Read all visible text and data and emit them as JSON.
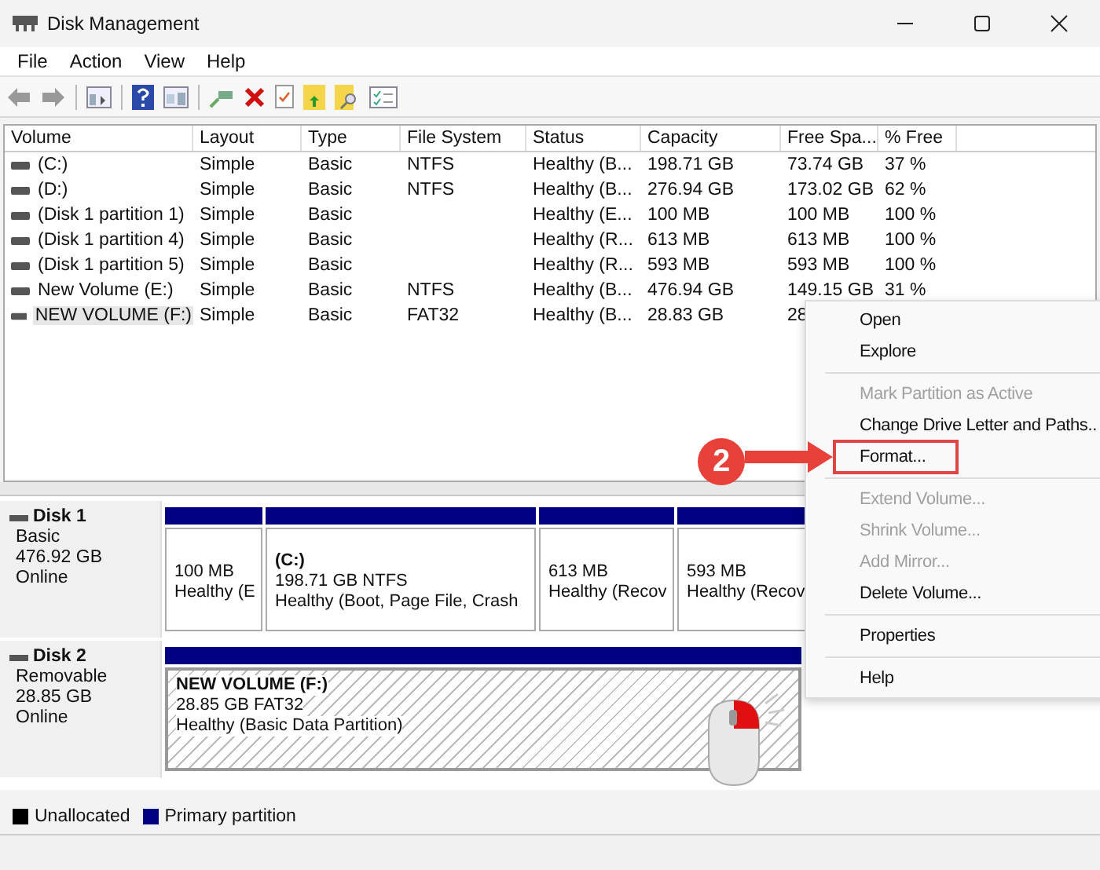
{
  "window": {
    "title": "Disk Management"
  },
  "menu_bar": [
    "File",
    "Action",
    "View",
    "Help"
  ],
  "table": {
    "columns": [
      "Volume",
      "Layout",
      "Type",
      "File System",
      "Status",
      "Capacity",
      "Free Spa...",
      "% Free"
    ],
    "rows": [
      {
        "selected": false,
        "cells": [
          "(C:)",
          "Simple",
          "Basic",
          "NTFS",
          "Healthy (B...",
          "198.71 GB",
          "73.74 GB",
          "37 %"
        ]
      },
      {
        "selected": false,
        "cells": [
          "(D:)",
          "Simple",
          "Basic",
          "NTFS",
          "Healthy (B...",
          "276.94 GB",
          "173.02 GB",
          "62 %"
        ]
      },
      {
        "selected": false,
        "cells": [
          "(Disk 1 partition 1)",
          "Simple",
          "Basic",
          "",
          "Healthy (E...",
          "100 MB",
          "100 MB",
          "100 %"
        ]
      },
      {
        "selected": false,
        "cells": [
          "(Disk 1 partition 4)",
          "Simple",
          "Basic",
          "",
          "Healthy (R...",
          "613 MB",
          "613 MB",
          "100 %"
        ]
      },
      {
        "selected": false,
        "cells": [
          "(Disk 1 partition 5)",
          "Simple",
          "Basic",
          "",
          "Healthy (R...",
          "593 MB",
          "593 MB",
          "100 %"
        ]
      },
      {
        "selected": false,
        "cells": [
          "New Volume (E:)",
          "Simple",
          "Basic",
          "NTFS",
          "Healthy (B...",
          "476.94 GB",
          "149.15 GB",
          "31 %"
        ]
      },
      {
        "selected": true,
        "cells": [
          "NEW VOLUME (F:)",
          "Simple",
          "Basic",
          "FAT32",
          "Healthy (B...",
          "28.83 GB",
          "28"
        ]
      }
    ]
  },
  "disks": [
    {
      "name": "Disk 1",
      "type": "Basic",
      "size": "476.92 GB",
      "status": "Online",
      "partitions": [
        {
          "size": "100 MB",
          "status": "Healthy (E",
          "selected": false
        },
        {
          "label": "(C:)",
          "size": "198.71 GB NTFS",
          "status": "Healthy (Boot, Page File, Crash",
          "selected": false
        },
        {
          "size": "613 MB",
          "status": "Healthy (Recov",
          "selected": false
        },
        {
          "size": "593 MB",
          "status": "Healthy (Recov",
          "selected": false
        }
      ]
    },
    {
      "name": "Disk 2",
      "type": "Removable",
      "size": "28.85 GB",
      "status": "Online",
      "partitions": [
        {
          "label": "NEW VOLUME  (F:)",
          "size": "28.85 GB FAT32",
          "status": "Healthy (Basic Data Partition)",
          "selected": true
        }
      ]
    }
  ],
  "legend": [
    {
      "label": "Unallocated",
      "color": "#000000"
    },
    {
      "label": "Primary partition",
      "color": "#000080"
    }
  ],
  "context_menu": [
    {
      "kind": "item",
      "label": "Open",
      "disabled": false
    },
    {
      "kind": "item",
      "label": "Explore",
      "disabled": false
    },
    {
      "kind": "separator"
    },
    {
      "kind": "item",
      "label": "Mark Partition as Active",
      "disabled": true
    },
    {
      "kind": "item",
      "label": "Change Drive Letter and Paths..",
      "disabled": false
    },
    {
      "kind": "item",
      "label": "Format...",
      "disabled": false,
      "highlighted": true
    },
    {
      "kind": "separator"
    },
    {
      "kind": "item",
      "label": "Extend Volume...",
      "disabled": true
    },
    {
      "kind": "item",
      "label": "Shrink Volume...",
      "disabled": true
    },
    {
      "kind": "item",
      "label": "Add Mirror...",
      "disabled": true
    },
    {
      "kind": "item",
      "label": "Delete Volume...",
      "disabled": false
    },
    {
      "kind": "separator"
    },
    {
      "kind": "item",
      "label": "Properties",
      "disabled": false
    },
    {
      "kind": "separator"
    },
    {
      "kind": "item",
      "label": "Help",
      "disabled": false
    }
  ],
  "callout": {
    "step": "2"
  }
}
